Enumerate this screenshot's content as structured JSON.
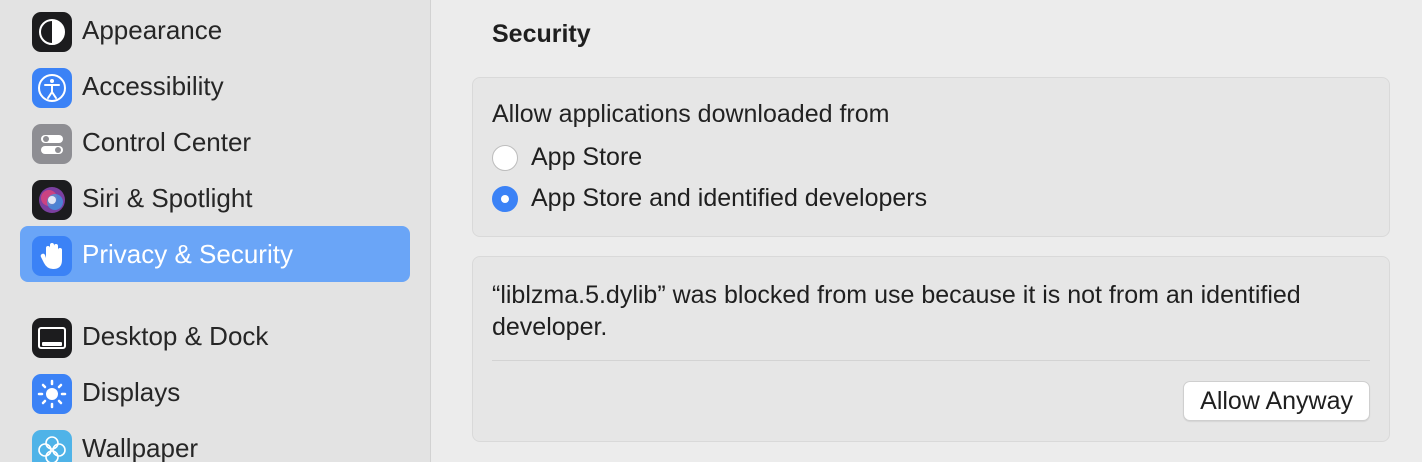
{
  "sidebar": {
    "items": [
      {
        "label": "Appearance",
        "icon": "appearance-icon"
      },
      {
        "label": "Accessibility",
        "icon": "accessibility-icon"
      },
      {
        "label": "Control Center",
        "icon": "control-center-icon"
      },
      {
        "label": "Siri & Spotlight",
        "icon": "siri-icon"
      },
      {
        "label": "Privacy & Security",
        "icon": "hand-icon",
        "selected": true
      },
      {
        "label": "Desktop & Dock",
        "icon": "dock-icon"
      },
      {
        "label": "Displays",
        "icon": "sun-icon"
      },
      {
        "label": "Wallpaper",
        "icon": "flower-icon"
      }
    ]
  },
  "main": {
    "section_title": "Security",
    "download_card": {
      "heading": "Allow applications downloaded from",
      "options": [
        {
          "label": "App Store",
          "selected": false
        },
        {
          "label": "App Store and identified developers",
          "selected": true
        }
      ]
    },
    "blocked_card": {
      "message": "“liblzma.5.dylib” was blocked from use because it is not from an identified developer.",
      "button_label": "Allow Anyway"
    }
  },
  "colors": {
    "accent": "#3b82f6",
    "selected_sidebar": "#6aa5f7"
  }
}
